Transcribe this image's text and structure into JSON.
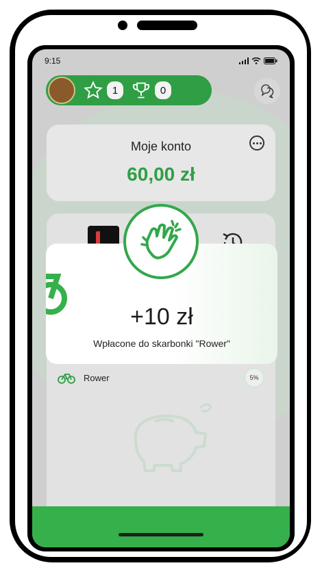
{
  "status_bar": {
    "time": "9:15",
    "signal_icon": "signal-icon",
    "wifi_icon": "wifi-icon",
    "battery_icon": "battery-icon"
  },
  "header": {
    "stars_count": "1",
    "trophies_count": "0"
  },
  "account": {
    "title": "Moje konto",
    "amount": "60,00 zł"
  },
  "goals": [
    {
      "name": "Rower",
      "progress_label": "5%"
    }
  ],
  "toast": {
    "amount": "+10 zł",
    "message": "Wpłacone do skarbonki \"Rower\""
  },
  "colors": {
    "brand_green": "#2f9e45",
    "accent_green": "#36b04a"
  }
}
